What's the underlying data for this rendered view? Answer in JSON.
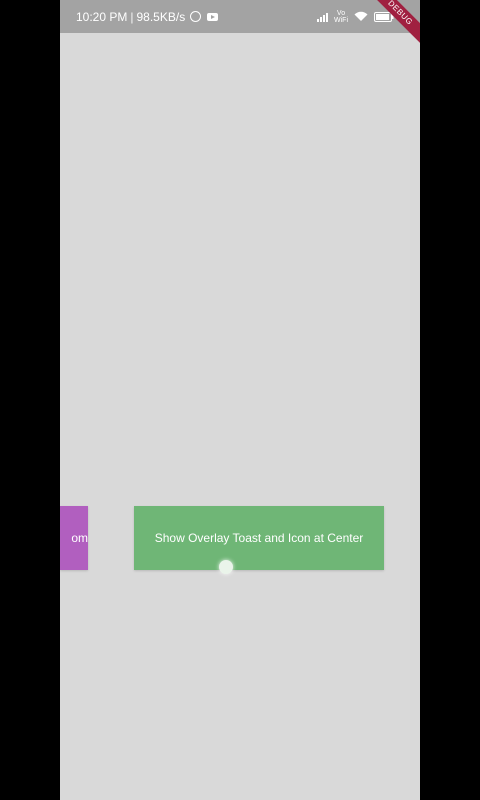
{
  "status_bar": {
    "time": "10:20 PM",
    "separator": "|",
    "speed": "98.5KB/s",
    "volte_top": "Vo",
    "volte_bottom": "WiFi",
    "icons": [
      "whatsapp-icon",
      "youtube-icon",
      "signal-icon",
      "volte-icon",
      "wifi-icon",
      "battery-icon"
    ]
  },
  "debug_banner": "DEBUG",
  "buttons": {
    "bottom_partial_label": "om",
    "center_label": "Show Overlay Toast and Icon at Center"
  },
  "colors": {
    "background": "#d9d9d9",
    "status_bar": "#a3a3a3",
    "bottom_button": "#b15fbf",
    "center_button": "#6fb676",
    "debug_banner": "#a02040"
  }
}
